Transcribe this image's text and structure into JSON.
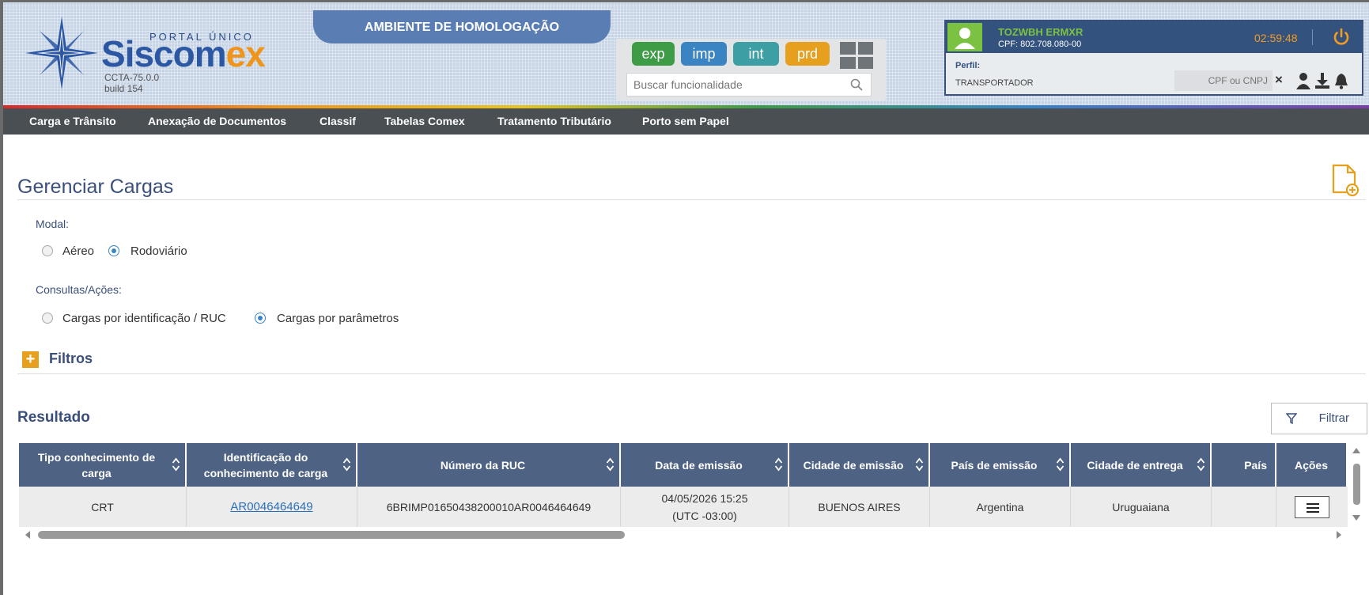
{
  "header": {
    "logo_portal": "PORTAL ÚNICO",
    "logo_sis": "Siscom",
    "logo_ex": "ex",
    "version": "CCTA-75.0.0",
    "build": "build 154",
    "environment_banner": "AMBIENTE DE HOMOLOGAÇÃO",
    "modules": [
      "exp",
      "imp",
      "int",
      "prd"
    ],
    "search_placeholder": "Buscar funcionalidade"
  },
  "user": {
    "name": "TOZWBH ERMXR",
    "cpf": "CPF: 802.708.080-00",
    "timer": "02:59:48",
    "perfil_label": "Perfil:",
    "perfil_value": "TRANSPORTADOR",
    "cpf_cnpj_placeholder": "CPF ou CNPJ",
    "clear_symbol": "×"
  },
  "nav": {
    "items": [
      "Carga e Trânsito",
      "Anexação de Documentos",
      "Classif",
      "Tabelas Comex",
      "Tratamento Tributário",
      "Porto sem Papel"
    ]
  },
  "page": {
    "title": "Gerenciar Cargas",
    "modal_label": "Modal:",
    "modal_options": [
      "Aéreo",
      "Rodoviário"
    ],
    "modal_selected": "Rodoviário",
    "consultas_label": "Consultas/Ações:",
    "consultas_options": [
      "Cargas por identificação / RUC",
      "Cargas por parâmetros"
    ],
    "consultas_selected": "Cargas por parâmetros",
    "filtros_plus": "+",
    "filtros_label": "Filtros",
    "resultado_label": "Resultado",
    "filtrar_button": "Filtrar"
  },
  "table": {
    "headers": [
      "Tipo conhecimento de carga",
      "Identificação do conhecimento de carga",
      "Número da RUC",
      "Data de emissão",
      "Cidade de emissão",
      "País de emissão",
      "Cidade de entrega",
      "País",
      "Ações"
    ],
    "rows": [
      {
        "tipo": "CRT",
        "identificacao": "AR0046464649",
        "ruc": "6BRIMP01650438200010AR0046464649",
        "data": "04/05/2026 15:25 (UTC -03:00)",
        "cidade_emissao": "BUENOS AIRES",
        "pais_emissao": "Argentina",
        "cidade_entrega": "Uruguaiana",
        "pais": ""
      }
    ]
  },
  "colors": {
    "header_bg": "#c6d4e6",
    "banner": "#5a7db3",
    "navbar": "#4a4f54",
    "table_header": "#4e6283",
    "accent_orange": "#e6a01e",
    "user_green": "#7cc242"
  }
}
